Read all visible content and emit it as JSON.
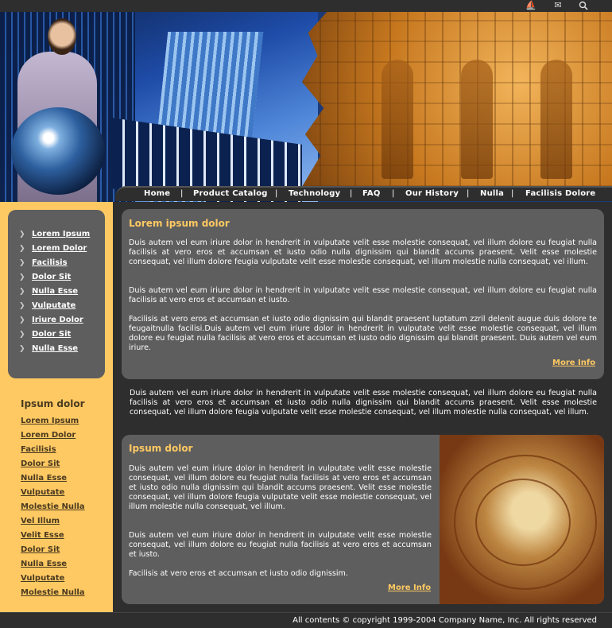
{
  "topbar": {
    "icons": [
      "boat-icon",
      "mail-icon",
      "search-icon"
    ]
  },
  "nav": {
    "items": [
      "Home",
      "Product Catalog",
      "Technology",
      "FAQ",
      "Our History",
      "Nulla",
      "Facilisis Dolore"
    ],
    "separator": "|"
  },
  "sidebar_box": {
    "bullet": "❯",
    "items": [
      "Lorem Ipsum",
      "Lorem Dolor",
      "Facilisis",
      "Dolor Sit",
      "Nulla Esse",
      "Vulputate",
      "Iriure Dolor",
      "Dolor Sit",
      "Nulla Esse"
    ]
  },
  "sidebar_list": {
    "title": "Ipsum dolor",
    "items": [
      "Lorem Ipsum",
      "Lorem Dolor",
      "Facilisis",
      "Dolor Sit",
      "Nulla Esse",
      "Vulputate",
      "Molestie Nulla",
      "Vel Illum",
      "Velit Esse",
      "Dolor Sit",
      "Nulla Esse",
      "Vulputate",
      "Molestie Nulla"
    ]
  },
  "panel1": {
    "title": "Lorem ipsum dolor",
    "paragraphs": [
      "Duis autem vel eum iriure dolor in hendrerit in vulputate velit esse molestie consequat, vel illum dolore eu feugiat nulla facilisis at vero eros et accumsan et iusto odio nulla dignissim qui blandit accums praesent. Velit esse molestie consequat, vel illum dolore feugia vulputate velit esse molestie consequat, vel illum molestie nulla consequat, vel illum.",
      "Duis autem vel eum iriure dolor in hendrerit in vulputate velit esse molestie consequat, vel illum dolore eu feugiat nulla facilisis at vero eros et accumsan et iusto.",
      "Facilisis at vero eros et accumsan et iusto odio dignissim qui blandit praesent luptatum zzril delenit augue duis dolore te feugaitnulla facilisi.Duis autem vel eum iriure dolor in hendrerit in vulputate velit esse molestie consequat, vel illum dolore eu feugiat nulla facilisis at vero eros et accumsan et iusto odio dignissim qui blandit praesent. Duis autem vel eum iriure."
    ],
    "more": "More Info"
  },
  "middle_text": "Duis autem vel eum iriure dolor in hendrerit in vulputate velit esse molestie consequat, vel illum dolore eu feugiat nulla facilisis at vero eros et accumsan et iusto odio nulla dignissim qui blandit accums praesent. Velit esse molestie consequat, vel illum dolore feugia vulputate velit esse molestie consequat, vel illum molestie nulla consequat, vel illum.",
  "panel2": {
    "title": "Ipsum dolor",
    "paragraphs": [
      "Duis autem vel eum iriure dolor in hendrerit in vulputate velit esse molestie consequat, vel illum dolore eu feugiat nulla facilisis at vero eros et accumsan et iusto odio nulla dignissim qui blandit accums praesent. Velit esse molestie consequat, vel illum dolore feugia vulputate velit esse molestie consequat, vel illum molestie nulla consequat, vel illum.",
      "Duis autem vel eum iriure dolor in hendrerit in vulputate velit esse molestie consequat, vel illum dolore eu feugiat nulla facilisis at vero eros et accumsan et iusto.",
      "Facilisis at vero eros et accumsan et iusto odio dignissim."
    ],
    "more": "More Info"
  },
  "footer": {
    "copyright": "All contents © copyright 1999-2004 Company Name, Inc. All rights reserved"
  },
  "colors": {
    "background": "#2e2e2e",
    "panel": "#5e5e5e",
    "accent": "#fec962"
  }
}
